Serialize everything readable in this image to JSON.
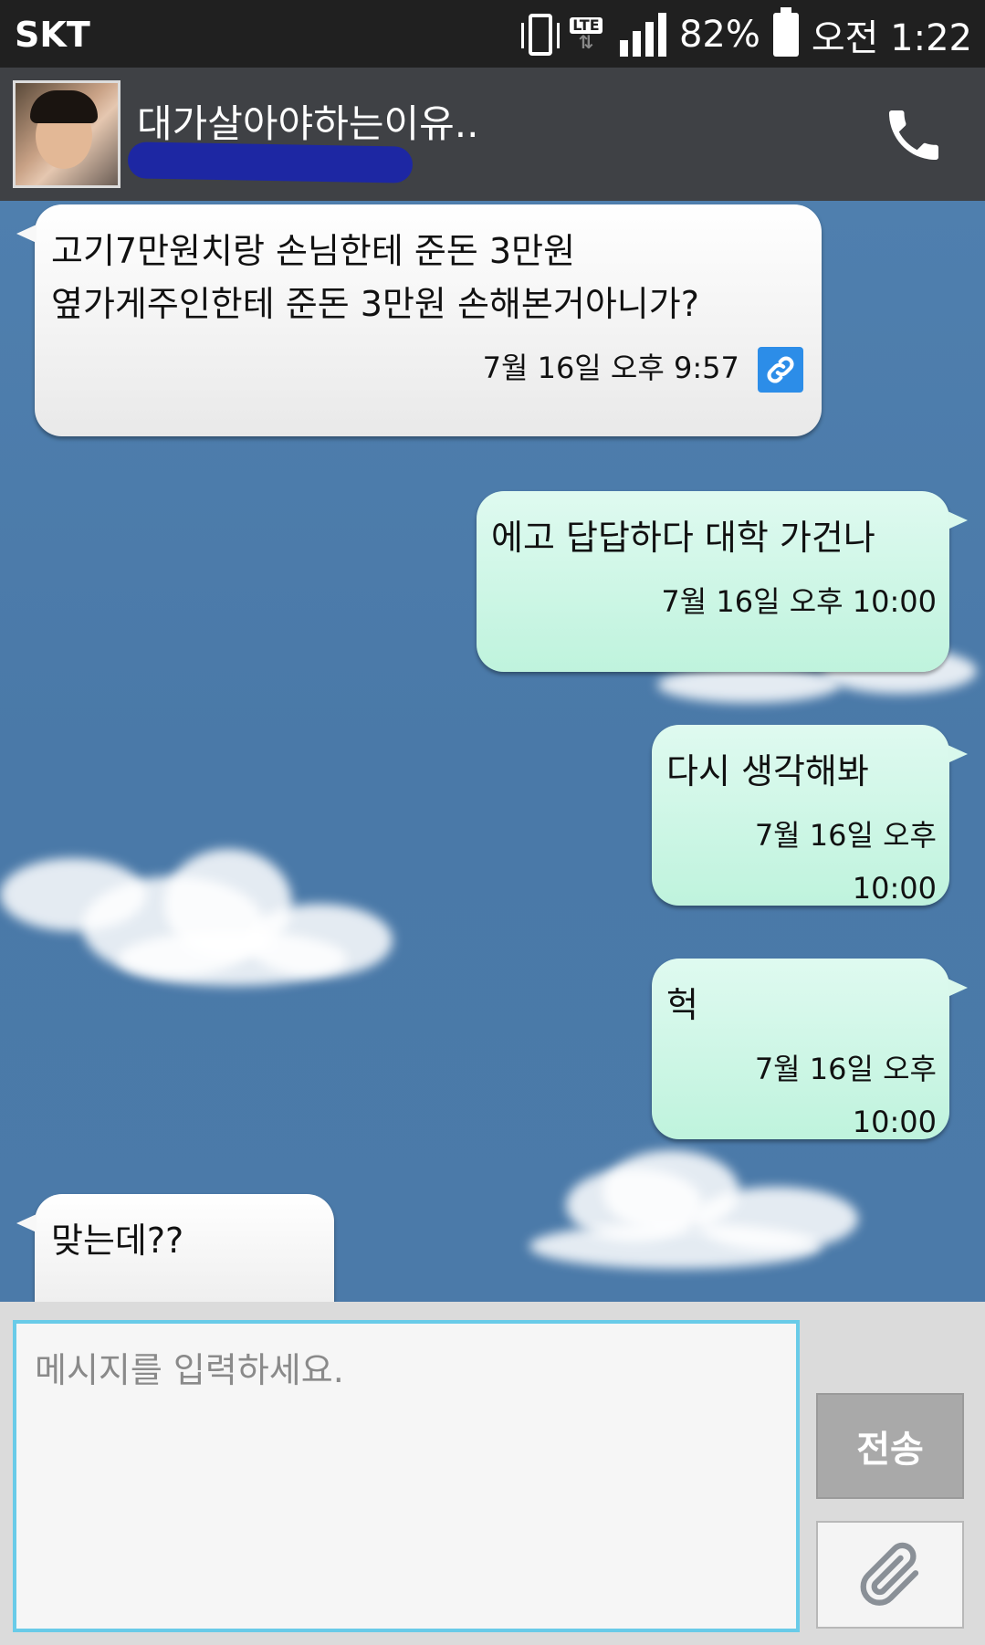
{
  "status_bar": {
    "carrier": "SKT",
    "network": "LTE",
    "battery_percent": "82%",
    "time": "오전 1:22"
  },
  "header": {
    "title": "대가살아야하는이유..",
    "call_icon": "phone-icon"
  },
  "messages": [
    {
      "direction": "in",
      "text": "고기7만원치랑 손님한테 준돈 3만원\n옆가게주인한테 준돈 3만원 손해본거아니가?",
      "time": "7월 16일 오후 9:57",
      "link_icon": "link-icon"
    },
    {
      "direction": "out",
      "text": "에고 답답하다 대학 가건나",
      "time": "7월 16일 오후 10:00"
    },
    {
      "direction": "out",
      "text": "다시 생각해봐",
      "time": "7월 16일 오후 10:00"
    },
    {
      "direction": "out",
      "text": "헉",
      "time": "7월 16일 오후 10:00"
    },
    {
      "direction": "in",
      "text": "맞는데??",
      "time": ""
    }
  ],
  "composer": {
    "placeholder": "메시지를 입력하세요.",
    "send_label": "전송",
    "attach_icon": "paperclip-icon"
  },
  "colors": {
    "chat_background": "#4a78a8",
    "outgoing_bubble": "#c6f5e2",
    "incoming_bubble": "#f2f2f2",
    "input_border": "#69cbe8",
    "header_background": "#3f4145",
    "link_badge": "#2c8de8"
  }
}
